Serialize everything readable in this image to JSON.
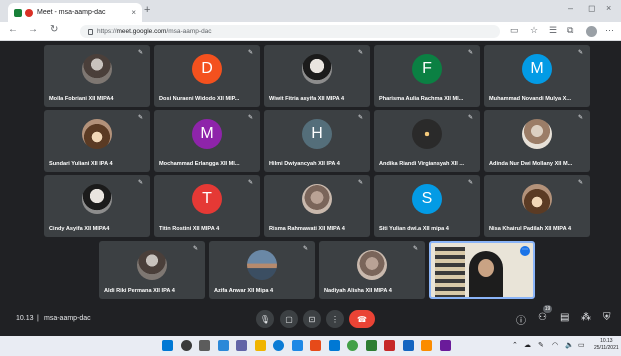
{
  "browser": {
    "tab_title": "Meet - msa-aamp-dac",
    "tab_close": "×",
    "new_tab": "+",
    "url_prefix": "https://",
    "url_host": "meet.google.com",
    "url_path": "/msa-aamp-dac",
    "window_controls": [
      "–",
      "◻",
      "×"
    ]
  },
  "participants": [
    {
      "name": "Molla Fobriani XII MIPA4",
      "avatar_letter": "",
      "avatar_color": "",
      "photo": "photo"
    },
    {
      "name": "Dosi Nuraeni Widodo XII MIP...",
      "avatar_letter": "D",
      "avatar_color": "#f4511e",
      "photo": ""
    },
    {
      "name": "Wiwit Fitria asyifa XII MIPA 4",
      "avatar_letter": "",
      "avatar_color": "",
      "photo": "photo2"
    },
    {
      "name": "Pharisma Aulia Rachma XII MI...",
      "avatar_letter": "F",
      "avatar_color": "#0b8043",
      "photo": ""
    },
    {
      "name": "Muhammad Novandi Mulya X...",
      "avatar_letter": "M",
      "avatar_color": "#039be5",
      "photo": ""
    },
    {
      "name": "Sundari Yuliani XII IPA 4",
      "avatar_letter": "",
      "avatar_color": "",
      "photo": "photo3"
    },
    {
      "name": "Mochammad Erlangga XII MI...",
      "avatar_letter": "M",
      "avatar_color": "#8e24aa",
      "photo": ""
    },
    {
      "name": "Hilmi Dwiyancyah XII IPA 4",
      "avatar_letter": "H",
      "avatar_color": "#546e7a",
      "photo": ""
    },
    {
      "name": "Andika Riandi Virgiansyah XII ...",
      "avatar_letter": "",
      "avatar_color": "",
      "photo": "photo4"
    },
    {
      "name": "Adinda Nur Dwi Mollany XII M...",
      "avatar_letter": "",
      "avatar_color": "",
      "photo": "photo5"
    },
    {
      "name": "Cindy Asyifa XII MIPA4",
      "avatar_letter": "",
      "avatar_color": "",
      "photo": "photo2"
    },
    {
      "name": "Titin Rostini XII MIPA 4",
      "avatar_letter": "T",
      "avatar_color": "#e53935",
      "photo": ""
    },
    {
      "name": "Risma Rahmawati XII MIPA 4",
      "avatar_letter": "",
      "avatar_color": "",
      "photo": "photo7"
    },
    {
      "name": "Siti Yulian dwi.a XII mipa 4",
      "avatar_letter": "S",
      "avatar_color": "#039be5",
      "photo": ""
    },
    {
      "name": "Nisa Khairul Padilah XII MIPA 4",
      "avatar_letter": "",
      "avatar_color": "",
      "photo": "photo3"
    },
    {
      "name": "Aldi Riki Permana XII IPA 4",
      "avatar_letter": "",
      "avatar_color": "",
      "photo": "photo"
    },
    {
      "name": "Azifa Anwar XII Mipa 4",
      "avatar_letter": "",
      "avatar_color": "",
      "photo": "photo6"
    },
    {
      "name": "Nadiyah Alisha XII MIPA 4",
      "avatar_letter": "",
      "avatar_color": "",
      "photo": "photo7"
    }
  ],
  "meeting": {
    "time": "10.13",
    "separator": "|",
    "code": "msa-aamp-dac",
    "people_count": "19",
    "end_call_icon": "phone-hangup-icon"
  },
  "taskbar": {
    "clock_time": "10.13",
    "clock_date": "25/11/2021"
  },
  "colors": {
    "meet_background": "#202124",
    "tile_background": "#3c4043",
    "end_call_red": "#ea4335",
    "active_speaker_border": "#8ab4f8"
  }
}
